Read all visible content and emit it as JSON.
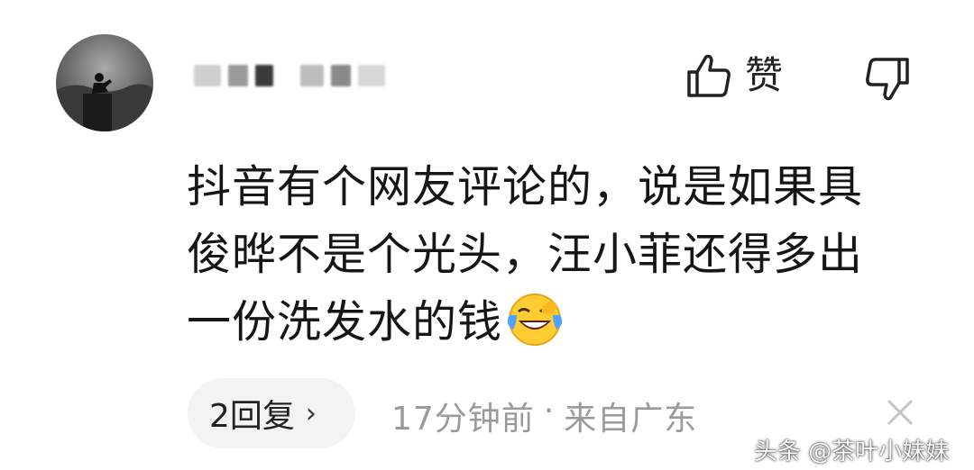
{
  "post": {
    "like_label": "赞",
    "comment_lines": [
      "抖音有个网友评论的，说是如果具",
      "俊晔不是个光头，汪小菲还得多出",
      "一份洗发水的钱"
    ]
  },
  "footer": {
    "reply_count_label": "2回复",
    "reply_chevron": "›",
    "timestamp": "17分钟前",
    "separator": "·",
    "location": "来自广东"
  },
  "watermark": {
    "text": "头条 @茶叶小妹妹"
  },
  "icons": {
    "avatar": "avatar-image",
    "like": "thumbs-up-icon",
    "dislike": "thumbs-down-icon",
    "emoji": "laughing-crying-emoji-icon",
    "close": "close-icon"
  },
  "colors": {
    "meta_text": "#9a9a9a",
    "pill_bg": "#f3f3f3",
    "text": "#161616"
  }
}
